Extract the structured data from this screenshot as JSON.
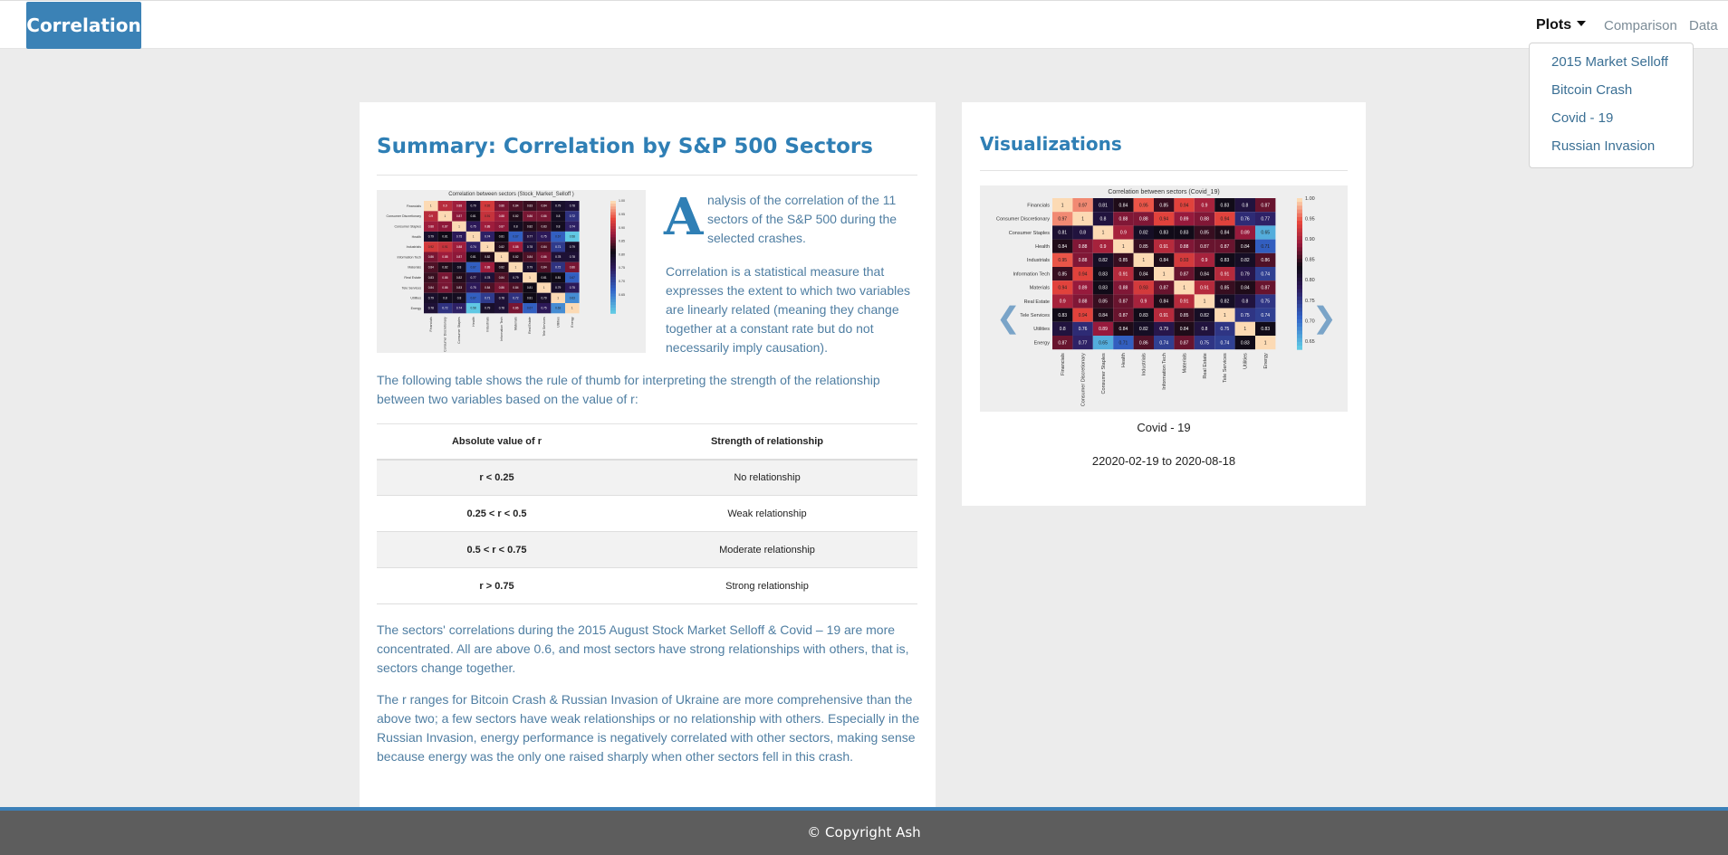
{
  "navbar": {
    "brand": "Correlation",
    "plots_label": "Plots",
    "comparison_label": "Comparison",
    "data_label": "Data",
    "dropdown_items": [
      "2015 Market Selloff",
      "Bitcoin Crash",
      "Covid - 19",
      "Russian Invasion"
    ]
  },
  "summary": {
    "title": "Summary: Correlation by S&P 500 Sectors",
    "thumb_title": "Correlation between sectors (Stock_Market_Selloff )",
    "dropcap": "A",
    "intro_rest": "nalysis of the correlation of the 11 sectors of the S&P 500 during the selected crashes.",
    "para2": "Correlation is a statistical measure that expresses the extent to which two variables are linearly related (meaning they change together at a constant rate but do not necessarily imply causation).",
    "para3": "The following table shows the rule of thumb for interpreting the strength of the relationship between two variables based on the value of r:",
    "table": {
      "headers": [
        "Absolute value of r",
        "Strength of relationship"
      ],
      "rows": [
        [
          "r < 0.25",
          "No relationship"
        ],
        [
          "0.25 < r < 0.5",
          "Weak relationship"
        ],
        [
          "0.5 < r < 0.75",
          "Moderate relationship"
        ],
        [
          "r > 0.75",
          "Strong relationship"
        ]
      ]
    },
    "para4": "The sectors' correlations during the 2015 August Stock Market Selloff & Covid – 19 are more concentrated. All are above 0.6, and most sectors have strong relationships with others, that is, sectors change together.",
    "para5": "The r ranges for Bitcoin Crash & Russian Invasion of Ukraine are more comprehensive than the above two; a few sectors have weak relationships or no relationship with others. Especially in the Russian Invasion, energy performance is negatively correlated with other sectors, making sense because energy was the only one raised sharply when other sectors fell in this crash."
  },
  "viz": {
    "title": "Visualizations",
    "heatmap_title": "Correlation between sectors (Covid_19)",
    "prev_icon": "❮",
    "next_icon": "❯",
    "caption": "Covid - 19",
    "dates": "22020-02-19 to 2020-08-18"
  },
  "sectors": [
    "Financials",
    "Consumer Discretionary",
    "Consumer Staples",
    "Health",
    "Industrials",
    "Information Tech",
    "Materials",
    "Real Estate",
    "Tele Services",
    "Utilities",
    "Energy"
  ],
  "colorbar_ticks": [
    "1.00",
    "0.95",
    "0.90",
    "0.85",
    "0.80",
    "0.75",
    "0.70",
    "0.65"
  ],
  "covid_matrix": [
    [
      1,
      0.97,
      0.81,
      0.84,
      0.95,
      0.85,
      0.94,
      0.9,
      0.83,
      0.8,
      0.87
    ],
    [
      0.97,
      1,
      0.8,
      0.88,
      0.88,
      0.94,
      0.89,
      0.88,
      0.94,
      0.76,
      0.77
    ],
    [
      0.81,
      0.8,
      1,
      0.9,
      0.82,
      0.83,
      0.83,
      0.85,
      0.84,
      0.89,
      0.65
    ],
    [
      0.84,
      0.88,
      0.9,
      1,
      0.85,
      0.91,
      0.88,
      0.87,
      0.87,
      0.84,
      0.71
    ],
    [
      0.95,
      0.88,
      0.82,
      0.85,
      1,
      0.84,
      0.93,
      0.9,
      0.83,
      0.82,
      0.86
    ],
    [
      0.85,
      0.94,
      0.83,
      0.91,
      0.84,
      1,
      0.87,
      0.84,
      0.91,
      0.79,
      0.74
    ],
    [
      0.94,
      0.89,
      0.83,
      0.88,
      0.93,
      0.87,
      1,
      0.91,
      0.85,
      0.84,
      0.87
    ],
    [
      0.9,
      0.88,
      0.85,
      0.87,
      0.9,
      0.84,
      0.91,
      1,
      0.82,
      0.8,
      0.75
    ],
    [
      0.83,
      0.94,
      0.84,
      0.87,
      0.83,
      0.91,
      0.85,
      0.82,
      1,
      0.75,
      0.74
    ],
    [
      0.8,
      0.76,
      0.89,
      0.84,
      0.82,
      0.79,
      0.84,
      0.8,
      0.75,
      1,
      0.83
    ],
    [
      0.87,
      0.77,
      0.65,
      0.71,
      0.86,
      0.74,
      0.87,
      0.75,
      0.74,
      0.83,
      1
    ]
  ],
  "selloff_matrix": [
    [
      1,
      0.9,
      0.88,
      0.79,
      0.92,
      0.86,
      0.84,
      0.83,
      0.84,
      0.79,
      0.78
    ],
    [
      0.9,
      1,
      0.87,
      0.81,
      0.91,
      0.88,
      0.82,
      0.86,
      0.86,
      0.8,
      0.72
    ],
    [
      0.88,
      0.87,
      1,
      0.75,
      0.88,
      0.87,
      0.8,
      0.82,
      0.83,
      0.8,
      0.74
    ],
    [
      0.79,
      0.81,
      0.75,
      1,
      0.74,
      0.81,
      0.67,
      0.77,
      0.75,
      0.67,
      0.58
    ],
    [
      0.92,
      0.91,
      0.88,
      0.74,
      1,
      0.82,
      0.88,
      0.78,
      0.84,
      0.71,
      0.79
    ],
    [
      0.86,
      0.88,
      0.87,
      0.81,
      0.82,
      1,
      0.82,
      0.84,
      0.86,
      0.78,
      0.78
    ],
    [
      0.84,
      0.82,
      0.8,
      0.67,
      0.88,
      0.82,
      1,
      0.79,
      0.84,
      0.72,
      0.86
    ],
    [
      0.83,
      0.86,
      0.82,
      0.77,
      0.78,
      0.84,
      0.79,
      1,
      0.81,
      0.81,
      0.67
    ],
    [
      0.84,
      0.86,
      0.83,
      0.75,
      0.84,
      0.86,
      0.84,
      0.81,
      1,
      0.79,
      0.75
    ],
    [
      0.79,
      0.8,
      0.8,
      0.67,
      0.71,
      0.78,
      0.72,
      0.81,
      0.79,
      1,
      0.63
    ],
    [
      0.78,
      0.72,
      0.74,
      0.58,
      0.79,
      0.78,
      0.86,
      0.67,
      0.75,
      0.63,
      1
    ]
  ],
  "footer": "© Copyright Ash"
}
